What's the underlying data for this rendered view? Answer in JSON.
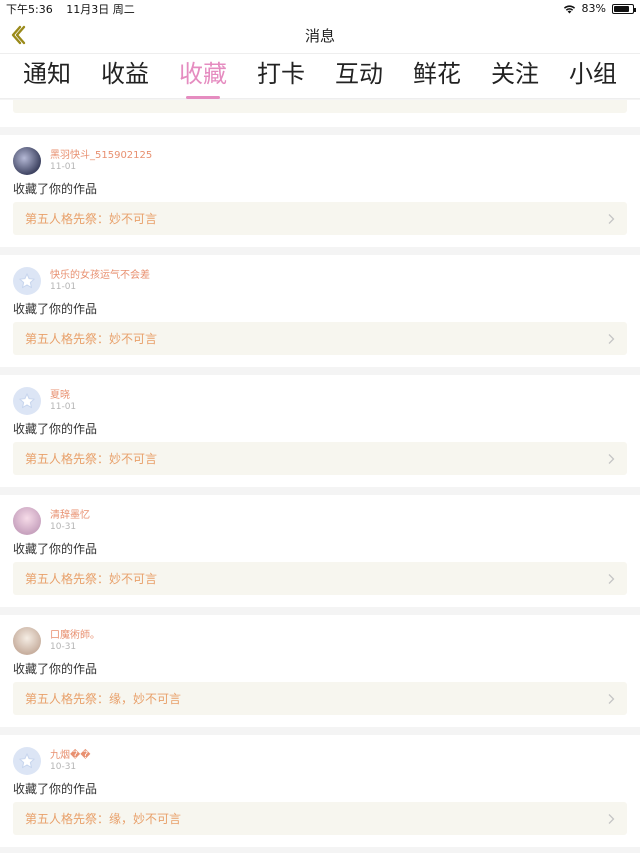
{
  "status_bar": {
    "time": "下午5:36",
    "date": "11月3日 周二",
    "battery": "83%",
    "battery_level": 0.83
  },
  "nav": {
    "title": "消息"
  },
  "tabs": [
    {
      "label": "通知",
      "active": false
    },
    {
      "label": "收益",
      "active": false
    },
    {
      "label": "收藏",
      "active": true
    },
    {
      "label": "打卡",
      "active": false
    },
    {
      "label": "互动",
      "active": false
    },
    {
      "label": "鲜花",
      "active": false
    },
    {
      "label": "关注",
      "active": false
    },
    {
      "label": "小组",
      "active": false
    }
  ],
  "notifications": [
    {
      "username": "黑羽快斗_515902125",
      "date": "11-01",
      "action": "收藏了你的作品",
      "work": "第五人格先祭：妙不可言",
      "avatar": "photo1"
    },
    {
      "username": "快乐的女孩运气不会差",
      "date": "11-01",
      "action": "收藏了你的作品",
      "work": "第五人格先祭：妙不可言",
      "avatar": "default"
    },
    {
      "username": "夏晓",
      "date": "11-01",
      "action": "收藏了你的作品",
      "work": "第五人格先祭：妙不可言",
      "avatar": "default"
    },
    {
      "username": "清辞墨忆",
      "date": "10-31",
      "action": "收藏了你的作品",
      "work": "第五人格先祭：妙不可言",
      "avatar": "photo2"
    },
    {
      "username": "口魔術師。",
      "date": "10-31",
      "action": "收藏了你的作品",
      "work": "第五人格先祭：缘，妙不可言",
      "avatar": "photo3"
    },
    {
      "username": "九烟��",
      "date": "10-31",
      "action": "收藏了你的作品",
      "work": "第五人格先祭：缘，妙不可言",
      "avatar": "default"
    }
  ]
}
